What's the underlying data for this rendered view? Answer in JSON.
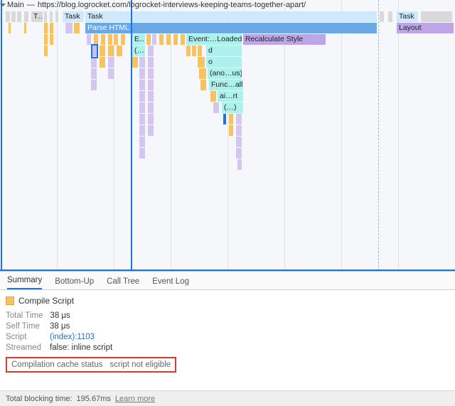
{
  "header": {
    "track_label": "Main",
    "url": "https://blog.logrocket.com/logrocket-interviews-keeping-teams-together-apart/"
  },
  "flame": {
    "rows": {
      "t_short": "T…",
      "task1": "Task",
      "task2": "Task",
      "parse_html": "Parse HTML",
      "layout": "Layout",
      "e_short": "E…",
      "event_loaded": "Event:…Loaded",
      "recalculate_style": "Recalculate Style",
      "paren1": "(…",
      "d": "d",
      "o": "o",
      "anon": "(ano…us)",
      "func_all": "Func…all",
      "ai_rt": "ai…rt",
      "paren2": "(…)"
    }
  },
  "tabs": {
    "summary": "Summary",
    "bottom_up": "Bottom-Up",
    "call_tree": "Call Tree",
    "event_log": "Event Log"
  },
  "summary": {
    "title": "Compile Script",
    "total_time_k": "Total Time",
    "total_time_v": "38 μs",
    "self_time_k": "Self Time",
    "self_time_v": "38 μs",
    "script_k": "Script",
    "script_link": "(index):1103",
    "streamed_k": "Streamed",
    "streamed_v": "false: inline script",
    "cache_k": "Compilation cache status",
    "cache_v": "script not eligible"
  },
  "footer": {
    "blocking_label": "Total blocking time:",
    "blocking_value": "195.67ms",
    "learn_more": "Learn more"
  }
}
